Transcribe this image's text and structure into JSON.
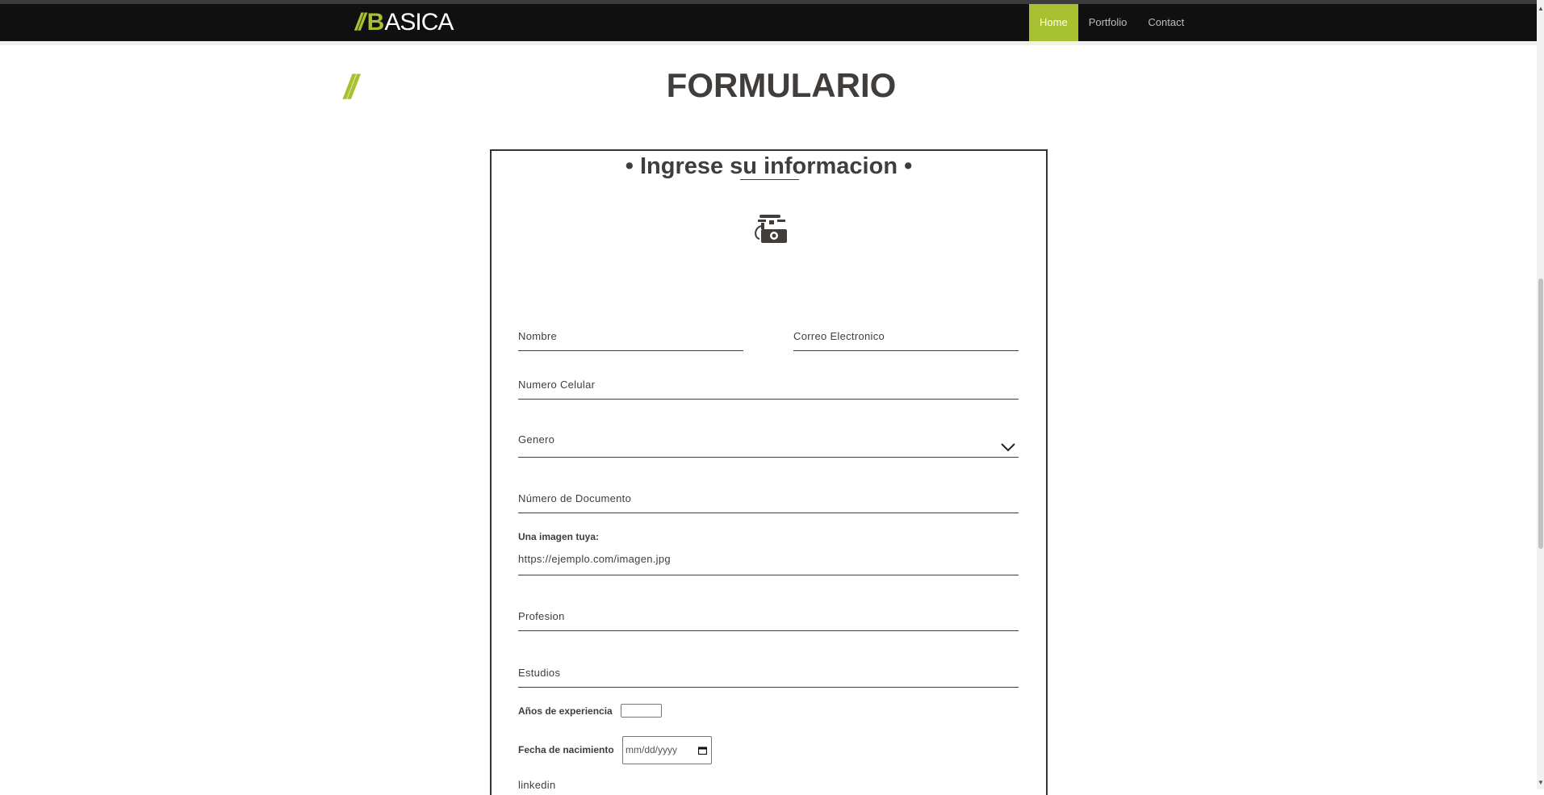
{
  "navbar": {
    "logo_slash": "//",
    "logo_b": "B",
    "logo_rest": "ASICA",
    "links": [
      "Home",
      "Portfolio",
      "Contact"
    ],
    "active": "Home"
  },
  "page": {
    "deco_slash": "//",
    "title": "FORMULARIO"
  },
  "form": {
    "heading": "• Ingrese su informacion •",
    "icon": "telephone-icon",
    "fields": {
      "nombre": "Nombre",
      "correo": "Correo Electronico",
      "celular": "Numero Celular",
      "genero": "Genero",
      "documento": "Número de Documento",
      "imagen_label": "Una imagen tuya:",
      "imagen_placeholder": "https://ejemplo.com/imagen.jpg",
      "profesion": "Profesion",
      "estudios": "Estudios",
      "experiencia_label": "Años de experiencia",
      "nacimiento_label": "Fecha de nacimiento",
      "nacimiento_placeholder": "mm/dd/yyyy",
      "linkedin": "linkedin"
    }
  },
  "colors": {
    "accent": "#a8c130",
    "navbar_bg": "#101010",
    "text": "#403d3b"
  }
}
